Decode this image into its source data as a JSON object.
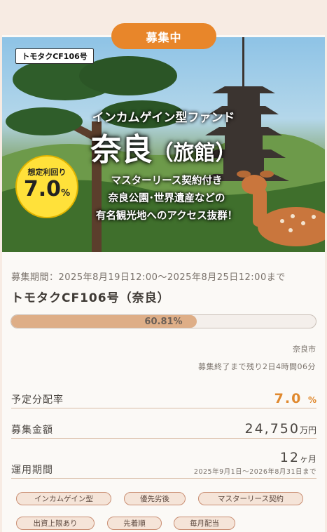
{
  "status_label": "募集中",
  "hero": {
    "fund_tag": "トモタクCF106号",
    "subtitle": "インカムゲイン型ファンド",
    "title_main": "奈良",
    "title_paren": "（旅館）",
    "yield_label": "想定利回り",
    "yield_value": "7.0",
    "yield_unit": "%",
    "lines": [
      "マスターリース契約付き",
      "奈良公園･世界遺産などの",
      "有名観光地へのアクセス抜群！"
    ]
  },
  "period": "募集期間：2025年8月19日12:00～2025年8月25日12:00まで",
  "fund_name": "トモタクCF106号（奈良）",
  "progress": {
    "percent": 60.81,
    "label": "60.81%"
  },
  "location": "奈良市",
  "remaining": "募集終了まで残り2日4時間06分",
  "rows": {
    "distribution": {
      "label": "予定分配率",
      "value": "7.0",
      "unit": "%"
    },
    "amount": {
      "label": "募集金額",
      "value": "24,750",
      "unit": "万円"
    },
    "term": {
      "label": "運用期間",
      "value": "12",
      "unit": "ヶ月",
      "sub": "2025年9月1日～2026年8月31日まで"
    }
  },
  "tags": [
    "インカムゲイン型",
    "優先劣後",
    "マスターリース契約",
    "出資上限あり",
    "先着順",
    "毎月配当"
  ],
  "colors": {
    "accent": "#e8862a",
    "progress_fill": "#deae87",
    "tag_bg": "#f5e4d8"
  }
}
